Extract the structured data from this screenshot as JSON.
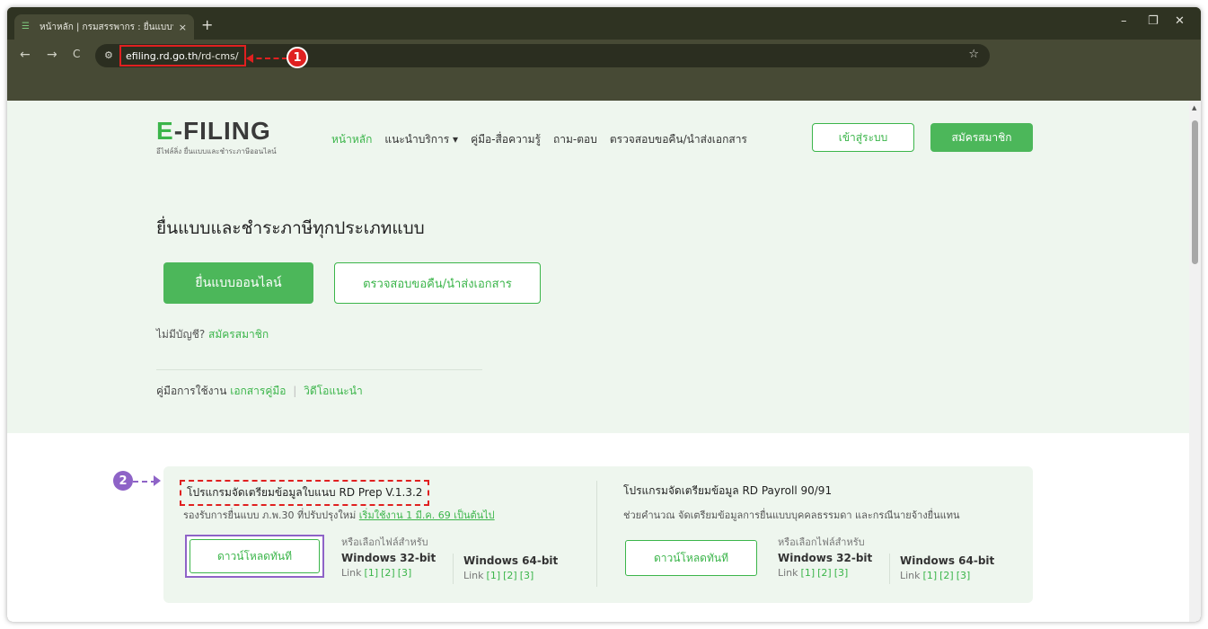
{
  "browser": {
    "tab_title": "หน้าหลัก | กรมสรรพากร : ยื่นแบบฯ",
    "new_tab": "+",
    "tab_close": "×",
    "win_minimize": "–",
    "win_restore": "❐",
    "win_close": "✕",
    "nav_back": "←",
    "nav_forward": "→",
    "nav_reload": "C",
    "site_info": "⚙",
    "url_host": "efiling.rd.go.th",
    "url_path": "/rd-cms/",
    "star": "☆",
    "annotation_1": "1"
  },
  "header": {
    "logo_text_e": "E",
    "logo_text_rest": "-FILING",
    "logo_sub": "อีไฟล์ลิ่ง ยื่นแบบและชำระภาษีออนไลน์",
    "nav": [
      "หน้าหลัก",
      "แนะนำบริการ ▾",
      "คู่มือ-สื่อความรู้",
      "ถาม-ตอบ",
      "ตรวจสอบขอคืน/นำส่งเอกสาร"
    ],
    "login_label": "เข้าสู่ระบบ",
    "register_label": "สมัครสมาชิก"
  },
  "hero": {
    "title": "ยื่นแบบและชำระภาษีทุกประเภทแบบ",
    "file_online_label": "ยื่นแบบออนไลน์",
    "check_refund_label": "ตรวจสอบขอคืน/นำส่งเอกสาร",
    "no_account_text": "ไม่มีบัญชี?",
    "no_account_link": "สมัครสมาชิก",
    "manual_text": "คู่มือการใช้งาน",
    "manual_link_doc": "เอกสารคู่มือ",
    "manual_sep": "|",
    "manual_link_video": "วิดีโอแนะนำ"
  },
  "downloads": {
    "prep": {
      "title": "โปรแกรมจัดเตรียมข้อมูลใบแนบ RD Prep V.1.3.2",
      "desc_prefix": "รองรับการยื่นแบบ ภ.พ.30 ที่ปรับปรุงใหม่",
      "desc_link": "เริ่มใช้งาน 1 มี.ค. 69 เป็นต้นไป",
      "download_label": "ดาวน์โหลดทันที",
      "or_choose": "หรือเลือกไฟล์สำหรับ",
      "win32": "Windows 32-bit",
      "win64": "Windows 64-bit",
      "links_label": "Link",
      "links": [
        "[1]",
        "[2]",
        "[3]"
      ]
    },
    "payroll": {
      "title": "โปรแกรมจัดเตรียมข้อมูล RD Payroll 90/91",
      "desc": "ช่วยคำนวณ จัดเตรียมข้อมูลการยื่นแบบบุคคลธรรมดา และกรณีนายจ้างยื่นแทน",
      "download_label": "ดาวน์โหลดทันที",
      "or_choose": "หรือเลือกไฟล์สำหรับ",
      "win32": "Windows 32-bit",
      "win64": "Windows 64-bit",
      "links_label": "Link",
      "links": [
        "[1]",
        "[2]",
        "[3]"
      ]
    },
    "annotation_2": "2"
  }
}
